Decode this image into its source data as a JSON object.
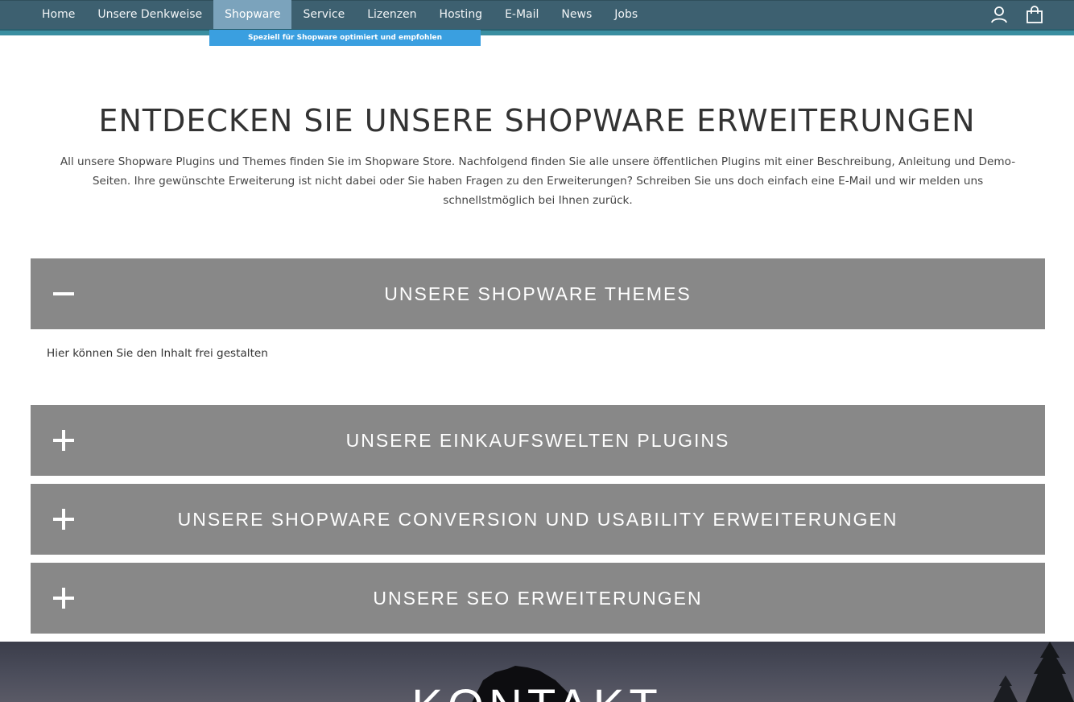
{
  "nav": {
    "items": [
      {
        "label": "Home"
      },
      {
        "label": "Unsere Denkweise"
      },
      {
        "label": "Shopware"
      },
      {
        "label": "Service"
      },
      {
        "label": "Lizenzen"
      },
      {
        "label": "Hosting"
      },
      {
        "label": "E-Mail"
      },
      {
        "label": "News"
      },
      {
        "label": "Jobs"
      }
    ],
    "active_item": "Shopware",
    "submenu_text": "Speziell für Shopware optimiert und empfohlen",
    "colors": {
      "bar": "#3d6070",
      "active": "#7ba3bc",
      "strip": "#3a8ea0",
      "submenu": "#3a9fe0"
    }
  },
  "icons": {
    "account": "user-icon",
    "cart": "shopping-bag-icon"
  },
  "hero": {
    "title": "ENTDECKEN SIE UNSERE SHOPWARE ERWEITERUNGEN",
    "text": "All unsere Shopware Plugins und Themes finden Sie im Shopware Store. Nachfolgend finden Sie alle unsere öffentlichen Plugins mit einer Beschreibung, Anleitung und Demo-Seiten. Ihre gewünschte Erweiterung ist nicht dabei oder Sie haben Fragen zu den Erweiterungen? Schreiben Sie uns doch einfach eine E-Mail und wir melden uns schnellstmöglich bei Ihnen zurück."
  },
  "accordions": [
    {
      "icon": "–",
      "title": "UNSERE SHOPWARE THEMES",
      "expanded": true,
      "content": "Hier können Sie den Inhalt frei gestalten"
    },
    {
      "icon": "+",
      "title": "UNSERE EINKAUFSWELTEN PLUGINS",
      "expanded": false
    },
    {
      "icon": "+",
      "title": "UNSERE SHOPWARE CONVERSION UND USABILITY ERWEITERUNGEN",
      "expanded": false
    },
    {
      "icon": "+",
      "title": "UNSERE SEO ERWEITERUNGEN",
      "expanded": false
    }
  ],
  "accordion_color": "#888888",
  "footer": {
    "title": "KONTAKT"
  }
}
